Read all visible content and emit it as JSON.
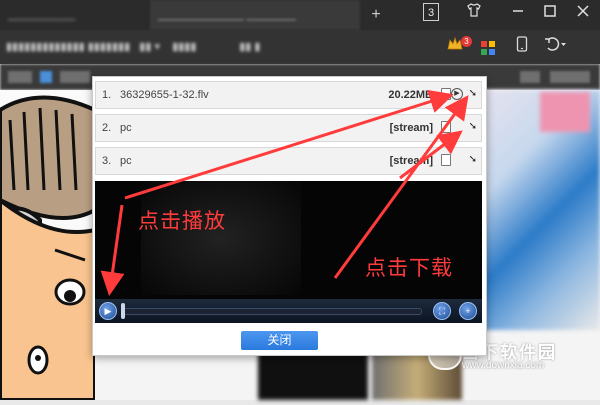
{
  "browser": {
    "tabs": [
      {
        "label": "___________"
      },
      {
        "label": "______________ ________"
      }
    ],
    "tab_counter": "3",
    "window_controls": [
      "shirt",
      "minimize",
      "maximize",
      "close"
    ],
    "extension_badge": "3"
  },
  "popup": {
    "items": [
      {
        "index": "1.",
        "name": "36329655-1-32.flv",
        "size": "20.22MB"
      },
      {
        "index": "2.",
        "name": "pc",
        "size": "[stream]"
      },
      {
        "index": "3.",
        "name": "pc",
        "size": "[stream]"
      }
    ],
    "close_label": "关闭"
  },
  "annotations": {
    "play_label": "点击播放",
    "download_label": "点击下载"
  },
  "watermark": {
    "name": "当下软件园",
    "url": "www.downxia.com"
  },
  "colors": {
    "accent_blue": "#2a79dd",
    "annotation_red": "#ff3b3b",
    "titlebar": "#2b2b2b",
    "player_bg": "#050505"
  }
}
